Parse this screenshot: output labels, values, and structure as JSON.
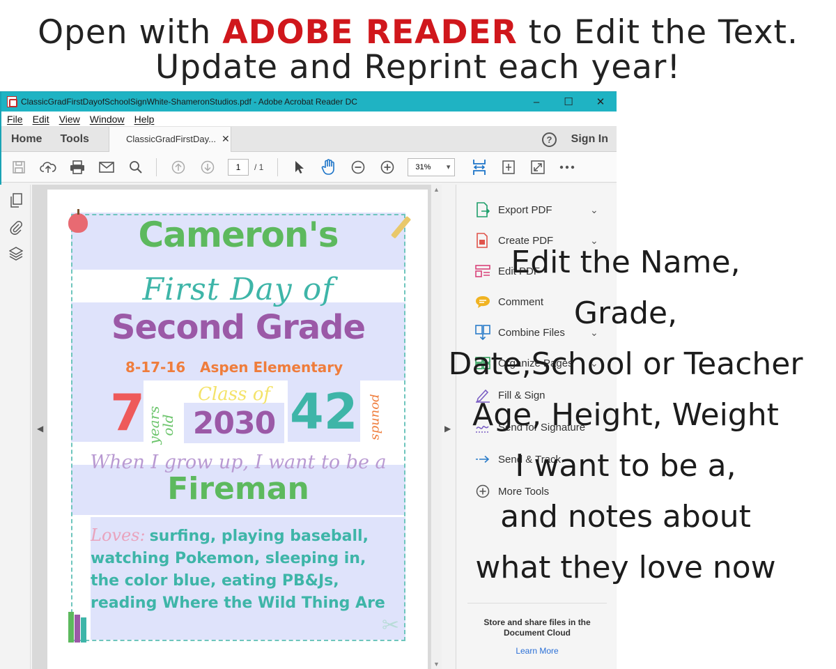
{
  "promo": {
    "line1_before": "Open with ",
    "line1_brand": "ADOBE READER",
    "line1_after": " to Edit the Text.",
    "line2": "Update and Reprint each year!"
  },
  "window": {
    "title": "ClassicGradFirstDayofSchoolSignWhite-ShameronStudios.pdf - Adobe Acrobat Reader DC",
    "controls": {
      "minimize": "–",
      "maximize": "☐",
      "close": "✕"
    },
    "menu": [
      "File",
      "Edit",
      "View",
      "Window",
      "Help"
    ],
    "tabs": {
      "home": "Home",
      "tools": "Tools",
      "doc_tab": "ClassicGradFirstDay...",
      "doc_close": "✕"
    },
    "help": "?",
    "sign_in": "Sign In",
    "toolbar": {
      "page_current": "1",
      "page_total": "/ 1",
      "zoom": "31%"
    }
  },
  "sign": {
    "name": "Cameron's",
    "first_day": "First Day of",
    "grade": "Second Grade",
    "date": "8-17-16",
    "school": "Aspen Elementary",
    "age": "7",
    "years_old": "years old",
    "class_of": "Class of",
    "class_year": "2030",
    "weight": "42",
    "pounds": "pounds",
    "grow_up": "When I grow up, I want to be a",
    "job": "Fireman",
    "loves_label": "Loves:",
    "loves_lines": [
      "surfing, playing baseball,",
      "watching Pokemon, sleeping in,",
      "the color blue, eating PB&Js,",
      "reading Where the Wild Thing Are"
    ]
  },
  "tools_pane": {
    "items": [
      {
        "label": "Export PDF",
        "icon": "export-pdf-icon",
        "color": "#1e9e6b"
      },
      {
        "label": "Create PDF",
        "icon": "create-pdf-icon",
        "color": "#e0544b"
      },
      {
        "label": "Edit PDF",
        "icon": "edit-pdf-icon",
        "color": "#d9437a"
      },
      {
        "label": "Comment",
        "icon": "comment-icon",
        "color": "#f0b322"
      },
      {
        "label": "Combine Files",
        "icon": "combine-files-icon",
        "color": "#2a7cc9"
      },
      {
        "label": "Organize Pages",
        "icon": "organize-pages-icon",
        "color": "#2ea05a"
      },
      {
        "label": "Fill & Sign",
        "icon": "fill-sign-icon",
        "color": "#7b5fc4"
      },
      {
        "label": "Send for Signature",
        "icon": "send-signature-icon",
        "color": "#7b5fc4"
      },
      {
        "label": "Send & Track",
        "icon": "send-track-icon",
        "color": "#2a7cc9"
      },
      {
        "label": "More Tools",
        "icon": "more-tools-icon",
        "color": "#555555"
      }
    ],
    "cloud_note": "Store and share files in the Document Cloud",
    "learn_more": "Learn More"
  },
  "callout": [
    "Edit the Name,",
    "Grade,",
    "Date,School or Teacher",
    "Age, Height, Weight",
    "I want to be a,",
    "and notes about",
    "what they love now"
  ]
}
